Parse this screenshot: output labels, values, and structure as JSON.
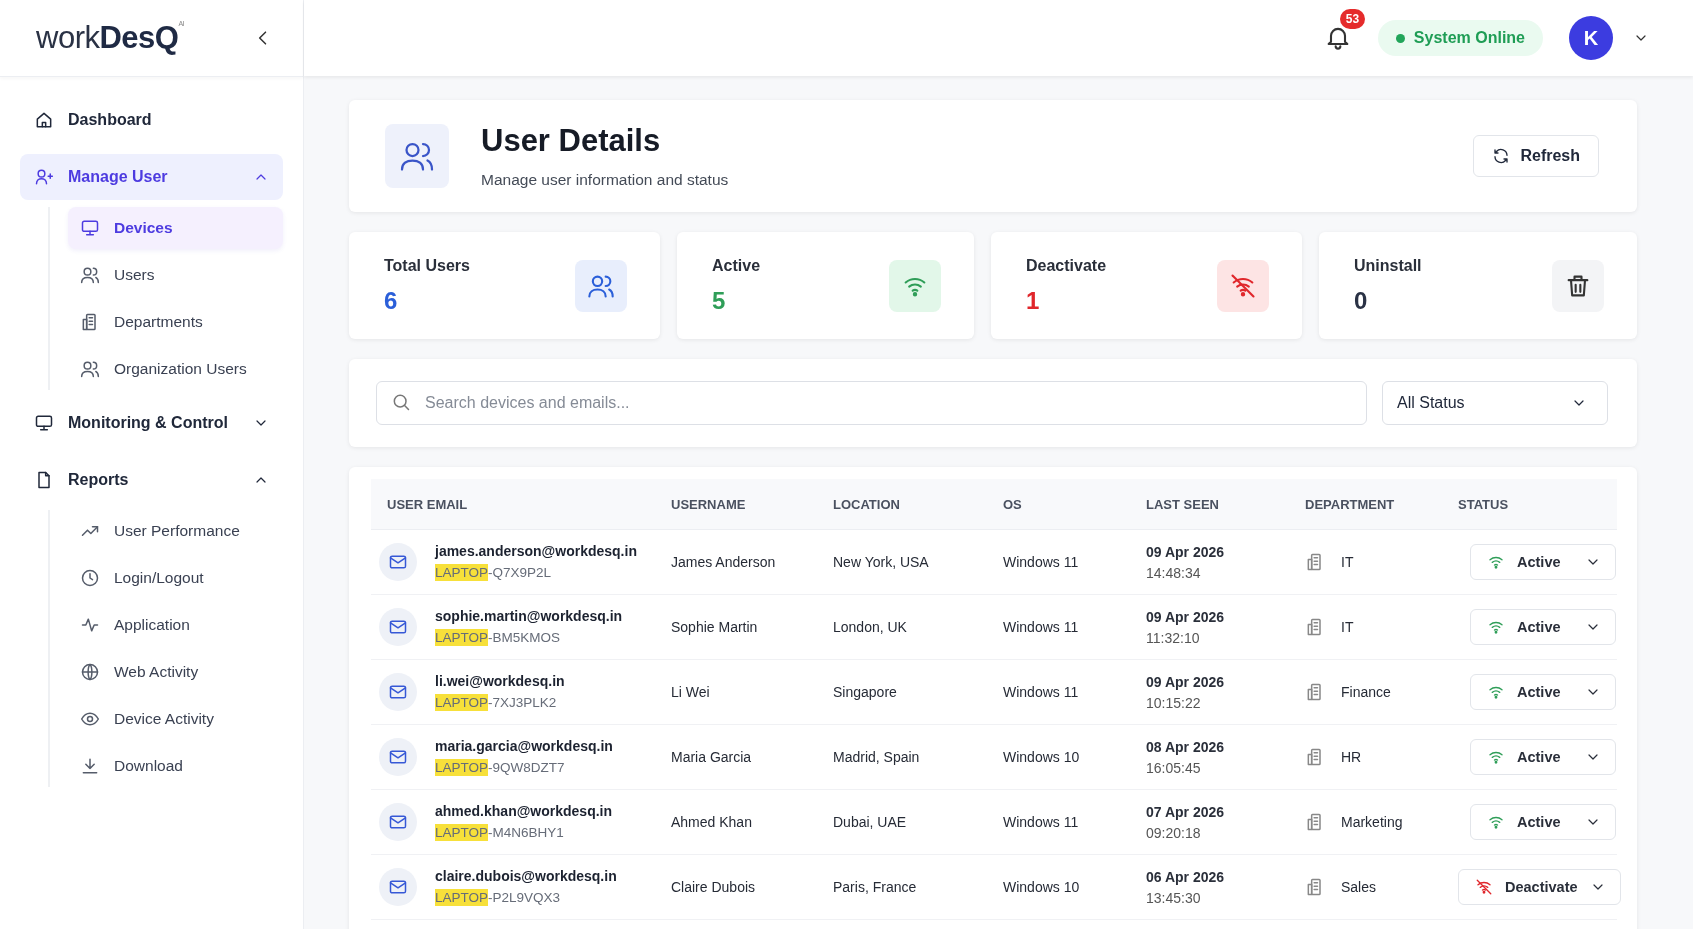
{
  "logo": "work**DesQ**$^{AI}$",
  "sidebar": {
    "items": [
      {
        "label": "Dashboard",
        "selected": false
      },
      {
        "label": "Manage User",
        "selected": true,
        "expanded": true,
        "children": [
          {
            "label": "Devices",
            "selected": true
          },
          {
            "label": "Users",
            "selected": false
          },
          {
            "label": "Departments",
            "selected": false
          },
          {
            "label": "Organization Users",
            "selected": false
          }
        ]
      },
      {
        "label": "Monitoring & Control",
        "selected": false,
        "expanded": false
      },
      {
        "label": "Reports",
        "selected": false,
        "expanded": true,
        "children": [
          {
            "label": "User Performance",
            "selected": false
          },
          {
            "label": "Login/Logout",
            "selected": false
          },
          {
            "label": "Application",
            "selected": false
          },
          {
            "label": "Web Activity",
            "selected": false
          },
          {
            "label": "Device Activity",
            "selected": false
          },
          {
            "label": "Download",
            "selected": false
          }
        ]
      }
    ]
  },
  "header": {
    "notifications": "53",
    "status": "System Online",
    "avatar": "K"
  },
  "page": {
    "title": "User Details",
    "subtitle": "Manage user information and status",
    "refresh": "Refresh"
  },
  "stats": [
    {
      "kind": "total",
      "label": "Total Users",
      "value": "6"
    },
    {
      "kind": "active",
      "label": "Active",
      "value": "5"
    },
    {
      "kind": "deactivate",
      "label": "Deactivate",
      "value": "1"
    },
    {
      "kind": "uninstall",
      "label": "Uninstall",
      "value": "0"
    }
  ],
  "search": {
    "placeholder": "Search devices and emails...",
    "filter": "All Status"
  },
  "table": {
    "columns": [
      "USER EMAIL",
      "USERNAME",
      "LOCATION",
      "OS",
      "LAST SEEN",
      "DEPARTMENT",
      "STATUS"
    ],
    "rows": [
      {
        "email": "james.anderson@workdesq.in",
        "device_highlight": "LAPTOP",
        "device_rest": "-Q7X9P2L",
        "username": "James Anderson",
        "location": "New York, USA",
        "os": "Windows 11",
        "date": "09 Apr 2026",
        "time": "14:48:34",
        "department": "IT",
        "status": {
          "kind": "active",
          "label": "Active"
        }
      },
      {
        "email": "sophie.martin@workdesq.in",
        "device_highlight": "LAPTOP",
        "device_rest": "-BM5KMOS",
        "username": "Sophie Martin",
        "location": "London, UK",
        "os": "Windows 11",
        "date": "09 Apr 2026",
        "time": "11:32:10",
        "department": "IT",
        "status": {
          "kind": "active",
          "label": "Active"
        }
      },
      {
        "email": "li.wei@workdesq.in",
        "device_highlight": "LAPTOP",
        "device_rest": "-7XJ3PLK2",
        "username": "Li Wei",
        "location": "Singapore",
        "os": "Windows 11",
        "date": "09 Apr 2026",
        "time": "10:15:22",
        "department": "Finance",
        "status": {
          "kind": "active",
          "label": "Active"
        }
      },
      {
        "email": "maria.garcia@workdesq.in",
        "device_highlight": "LAPTOP",
        "device_rest": "-9QW8DZT7",
        "username": "Maria Garcia",
        "location": "Madrid, Spain",
        "os": "Windows 10",
        "date": "08 Apr 2026",
        "time": "16:05:45",
        "department": "HR",
        "status": {
          "kind": "active",
          "label": "Active"
        }
      },
      {
        "email": "ahmed.khan@workdesq.in",
        "device_highlight": "LAPTOP",
        "device_rest": "-M4N6BHY1",
        "username": "Ahmed Khan",
        "location": "Dubai, UAE",
        "os": "Windows 11",
        "date": "07 Apr 2026",
        "time": "09:20:18",
        "department": "Marketing",
        "status": {
          "kind": "active",
          "label": "Active"
        }
      },
      {
        "email": "claire.dubois@workdesq.in",
        "device_highlight": "LAPTOP",
        "device_rest": "-P2L9VQX3",
        "username": "Claire Dubois",
        "location": "Paris, France",
        "os": "Windows 10",
        "date": "06 Apr 2026",
        "time": "13:45:30",
        "department": "Sales",
        "status": {
          "kind": "deactivate",
          "label": "Deactivate"
        }
      }
    ]
  }
}
